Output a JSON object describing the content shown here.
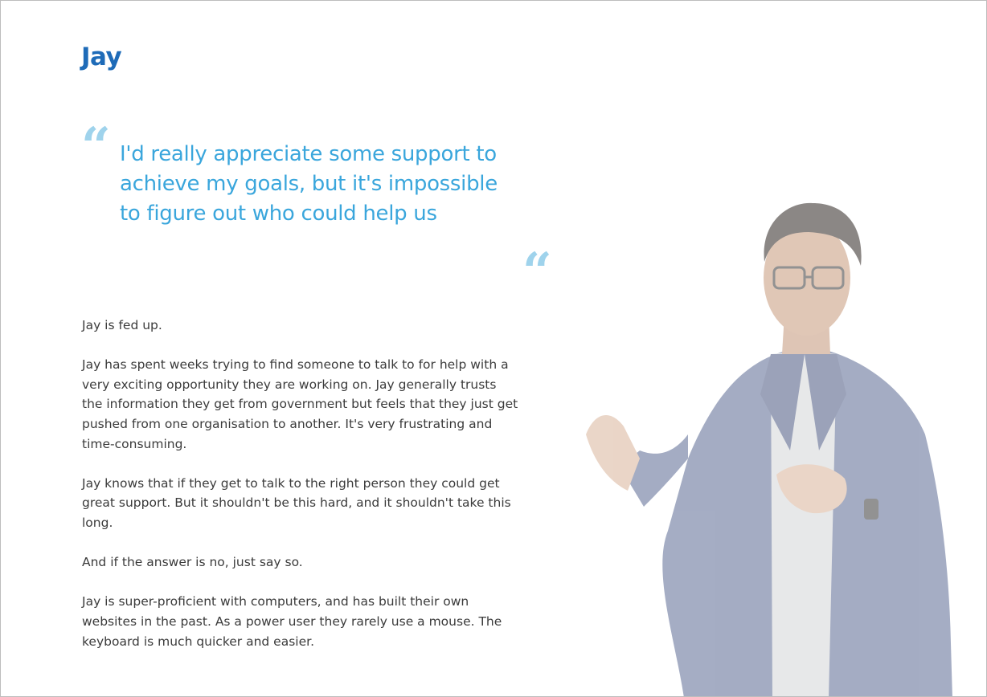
{
  "persona": {
    "name": "Jay",
    "quote": "I'd really appreciate some support to achieve my goals, but it's impossible to figure out who could help us",
    "quote_open_glyph": "“",
    "quote_close_glyph": "“",
    "paragraphs": [
      "Jay is fed up.",
      "Jay has spent weeks trying to find someone to talk to for help with a very exciting opportunity they are working on. Jay generally trusts the information they get from government but feels that they just get pushed from one organisation to another. It's very frustrating and time-consuming.",
      "Jay knows that if they get to talk to the right person they could get great support. But it shouldn't be this hard, and it shouldn't take this long.",
      "And if the answer is no, just say so.",
      "Jay is super-proficient with computers, and has built their own websites in the past. As a power user they rarely use a mouse. The keyboard is much quicker and easier."
    ]
  },
  "colors": {
    "title": "#1e6bb8",
    "quote": "#3aa6dc",
    "quote_mark": "#9fd3ec",
    "body": "#3b3b3b"
  },
  "photo": {
    "icon": "person-photo",
    "description_hidden": ""
  }
}
